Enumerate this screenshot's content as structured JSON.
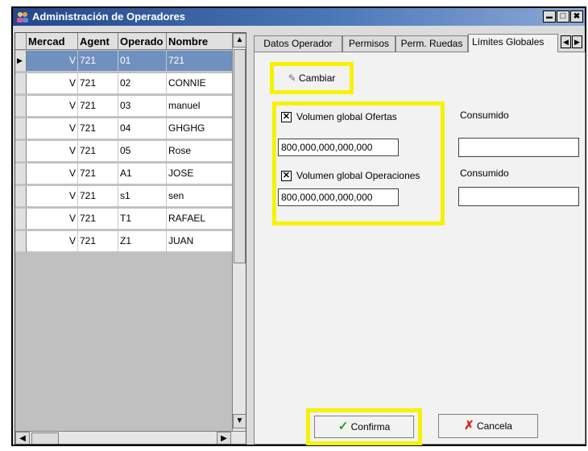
{
  "window": {
    "title": "Administración de Operadores"
  },
  "title_buttons": [
    "▬",
    "□",
    "✖"
  ],
  "grid": {
    "columns": [
      "Mercad",
      "Agent",
      "Operado",
      "Nombre"
    ],
    "rows": [
      {
        "mercado": "V",
        "agente": "721",
        "operador": "01",
        "nombre": "721",
        "selected": true
      },
      {
        "mercado": "V",
        "agente": "721",
        "operador": "02",
        "nombre": "CONNIE"
      },
      {
        "mercado": "V",
        "agente": "721",
        "operador": "03",
        "nombre": "manuel"
      },
      {
        "mercado": "V",
        "agente": "721",
        "operador": "04",
        "nombre": "GHGHG"
      },
      {
        "mercado": "V",
        "agente": "721",
        "operador": "05",
        "nombre": "Rose"
      },
      {
        "mercado": "V",
        "agente": "721",
        "operador": "A1",
        "nombre": "JOSE"
      },
      {
        "mercado": "V",
        "agente": "721",
        "operador": "s1",
        "nombre": "sen"
      },
      {
        "mercado": "V",
        "agente": "721",
        "operador": "T1",
        "nombre": "RAFAEL"
      },
      {
        "mercado": "V",
        "agente": "721",
        "operador": "Z1",
        "nombre": "JUAN"
      }
    ]
  },
  "tabs": [
    "Datos Operador",
    "Permisos",
    "Perm. Ruedas",
    "Límites Globales"
  ],
  "panel": {
    "cambiar_label": "Cambiar",
    "vol_ofertas_label": "Volumen global Ofertas",
    "vol_ofertas_value": "800,000,000,000,000",
    "vol_ofertas_checked": true,
    "vol_operaciones_label": "Volumen global Operaciones",
    "vol_operaciones_value": "800,000,000,000,000",
    "vol_operaciones_checked": true,
    "consumido_label_1": "Consumido",
    "consumido_label_2": "Consumido",
    "consumido_value_1": "",
    "consumido_value_2": ""
  },
  "buttons": {
    "confirma": "Confirma",
    "cancela": "Cancela"
  },
  "colors": {
    "highlight": "#f5f300",
    "selection": "#7090c0",
    "titlebar": "#24478a"
  }
}
